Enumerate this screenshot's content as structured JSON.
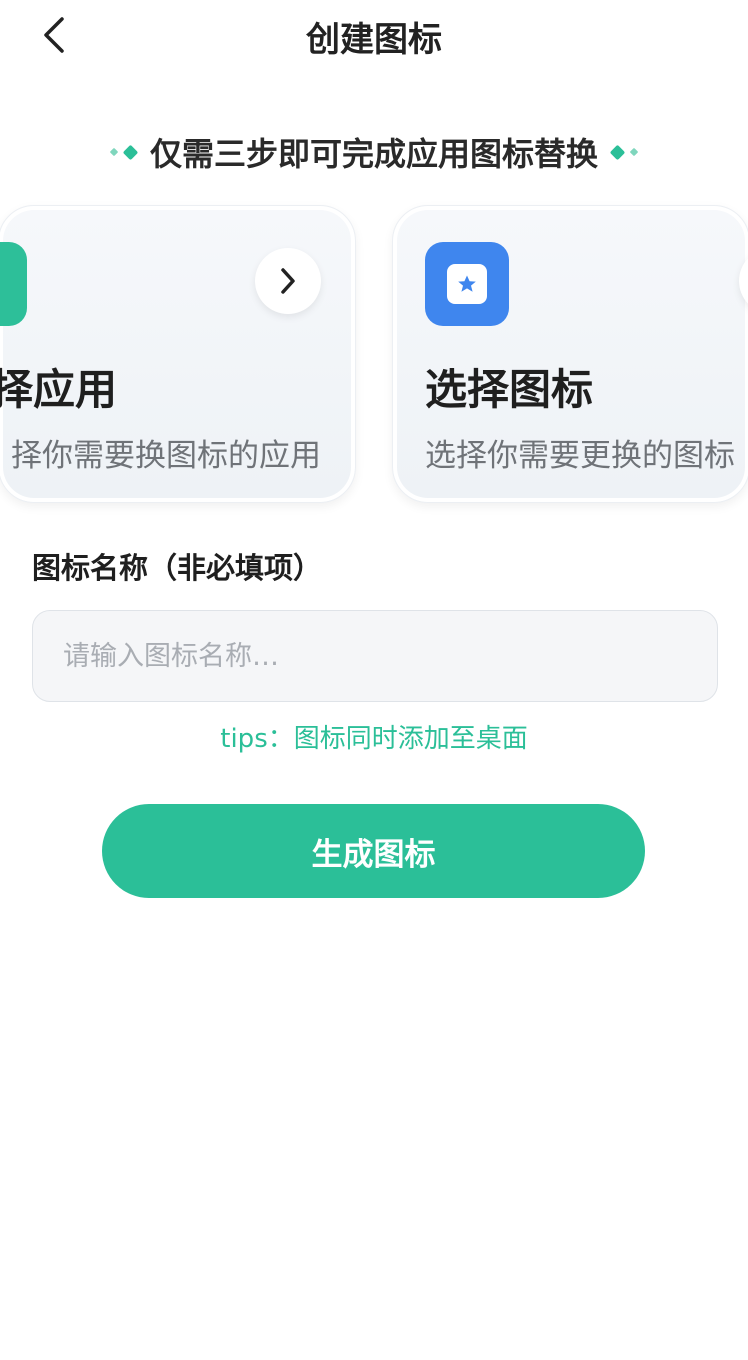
{
  "header": {
    "title": "创建图标",
    "back_icon": "chevron-left-icon"
  },
  "subtitle": "仅需三步即可完成应用图标替换",
  "colors": {
    "accent": "#2bbf98",
    "accent_light": "#7fd6bd",
    "blue_icon": "#3f86ee"
  },
  "cards": [
    {
      "title": "择应用",
      "desc": "择你需要换图标的应用",
      "icon": "app-icon",
      "action_icon": "chevron-right-icon"
    },
    {
      "title": "选择图标",
      "desc": "选择你需要更换的图标",
      "icon": "star-icon",
      "action_icon": "chevron-right-icon"
    }
  ],
  "form": {
    "label": "图标名称（非必填项）",
    "value": "",
    "placeholder": "请输入图标名称…"
  },
  "tips": "tips：图标同时添加至桌面",
  "generate_button": "生成图标"
}
